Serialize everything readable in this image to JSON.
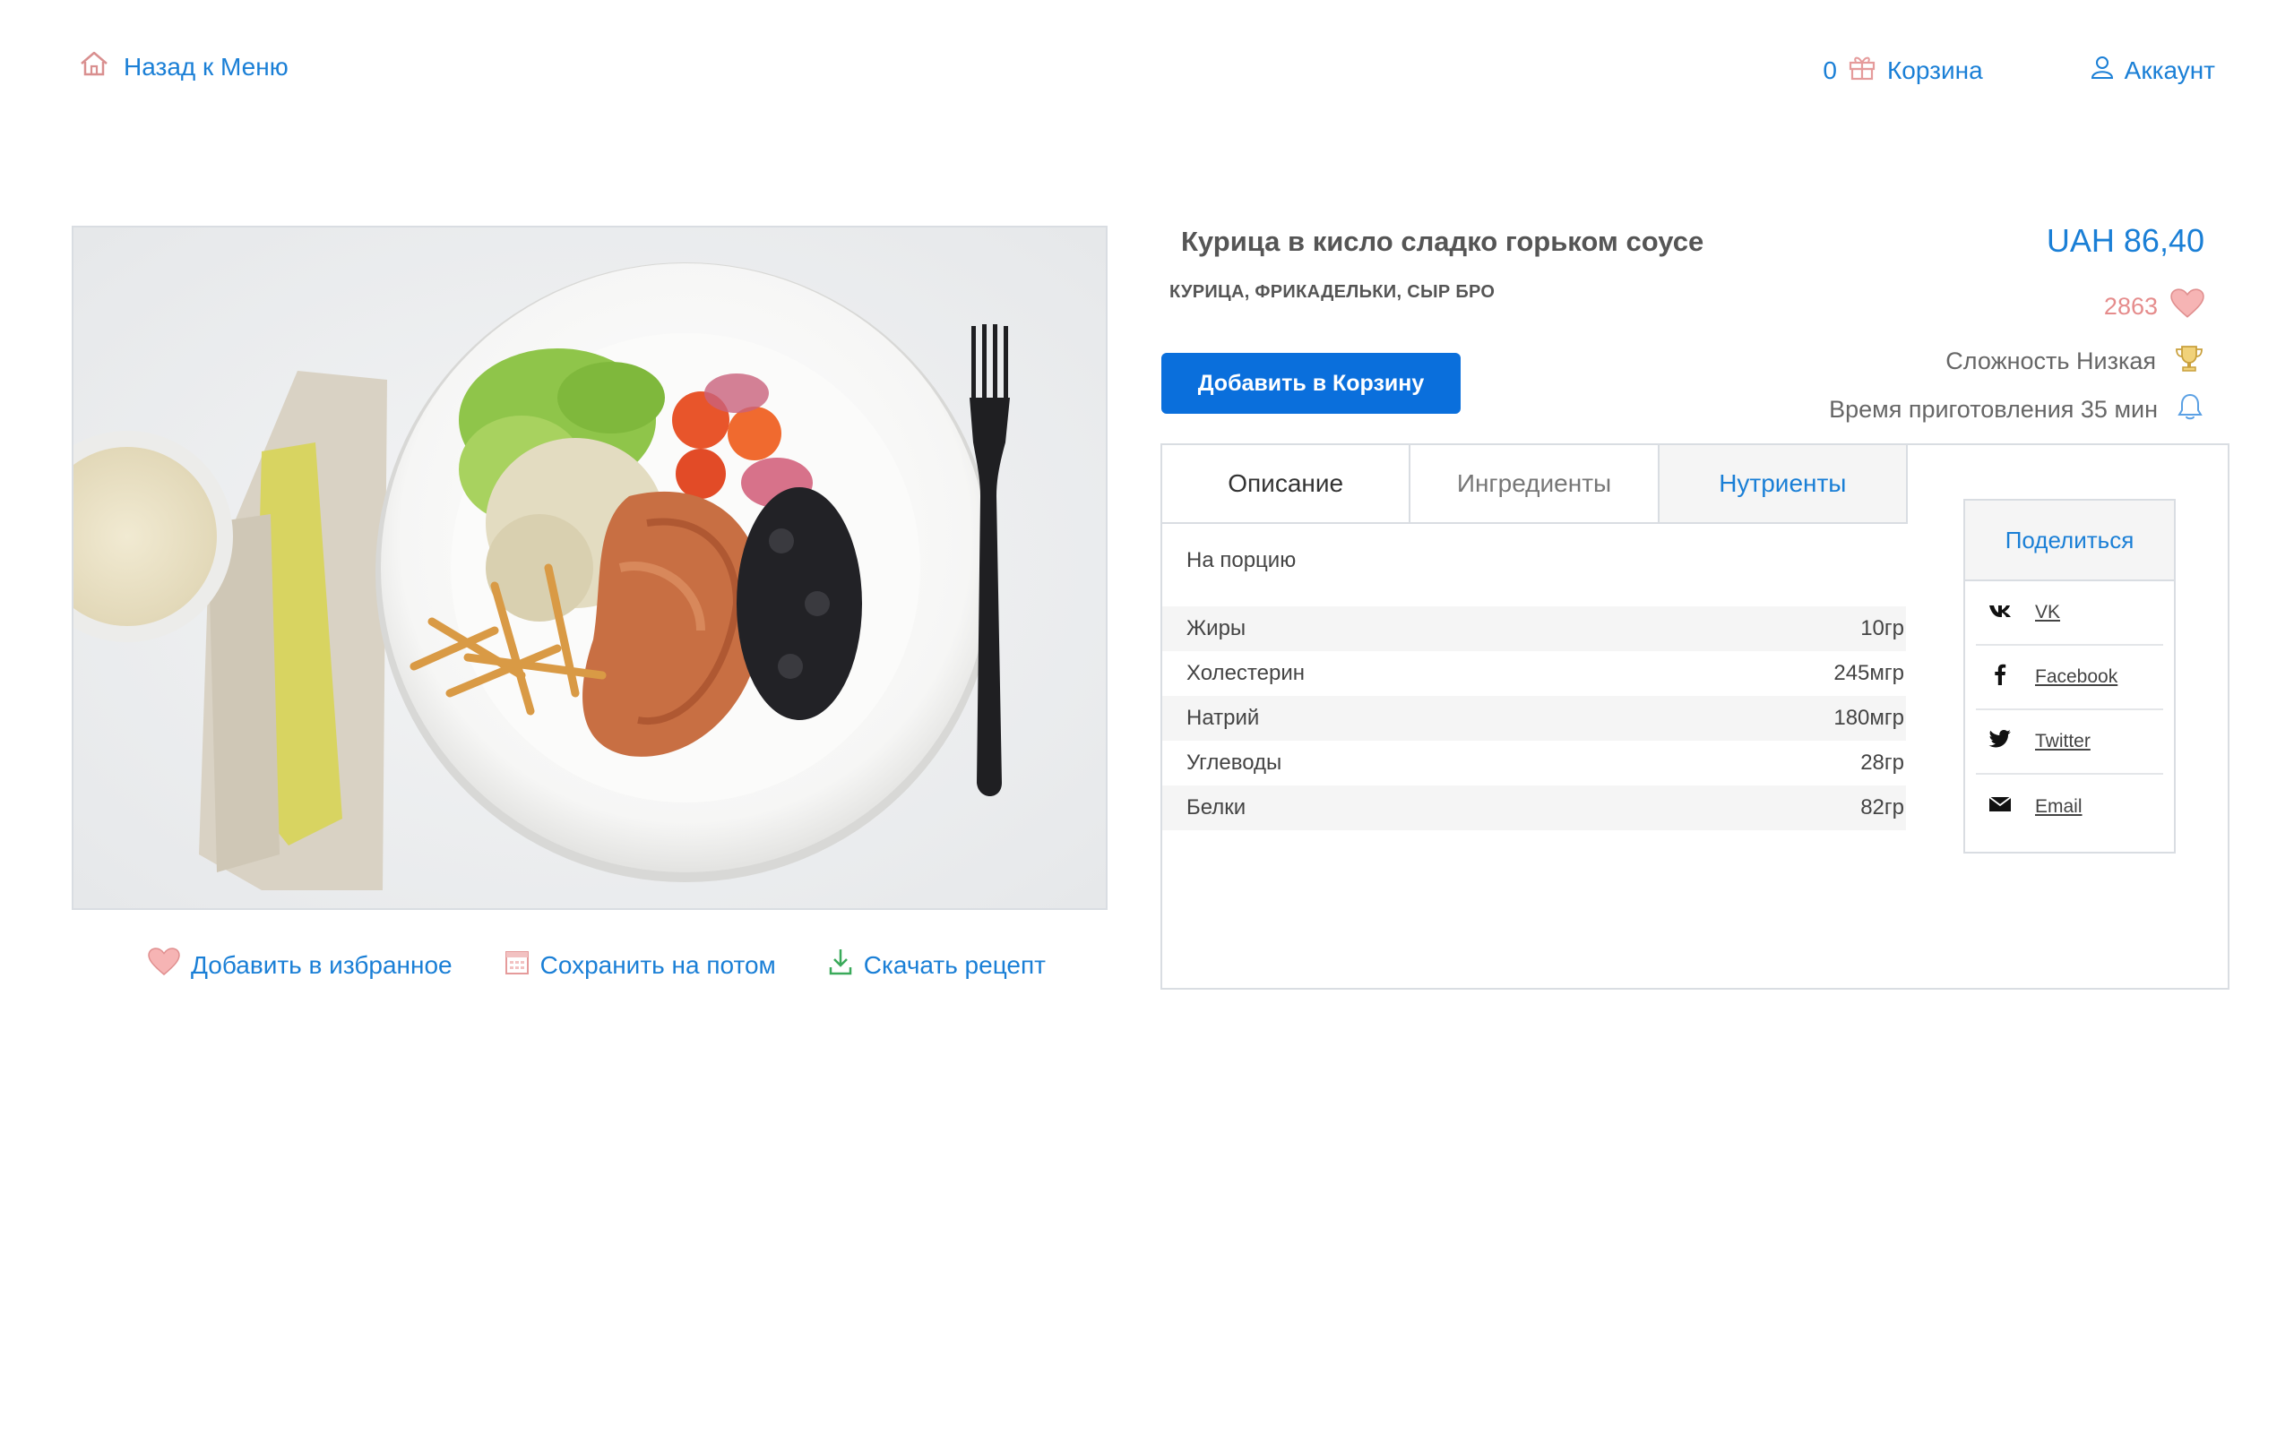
{
  "header": {
    "back_label": "Назад к Меню",
    "cart_count": "0",
    "cart_label": "Корзина",
    "account_label": "Аккаунт"
  },
  "product": {
    "title": "Курица в кисло сладко горьком соусе",
    "subtitle": "КУРИЦА, ФРИКАДЕЛЬКИ, СЫР БРО",
    "price": "UAH 86,40",
    "likes": "2863",
    "add_to_cart": "Добавить в Корзину",
    "difficulty": "Сложность Низкая",
    "cook_time": "Время приготовления 35 мин"
  },
  "photo_actions": {
    "favorite": "Добавить в избранное",
    "save_later": "Сохранить на потом",
    "download": "Скачать рецепт"
  },
  "tabs": [
    {
      "label": "Описание"
    },
    {
      "label": "Ингредиенты"
    },
    {
      "label": "Нутриенты"
    }
  ],
  "active_tab": "Нутриенты",
  "nutrition": {
    "per_portion": "На порцию",
    "rows": [
      {
        "name": "Жиры",
        "value": "10гр"
      },
      {
        "name": "Холестерин",
        "value": "245мгр"
      },
      {
        "name": "Натрий",
        "value": "180мгр"
      },
      {
        "name": "Углеводы",
        "value": "28гр"
      },
      {
        "name": "Белки",
        "value": "82гр"
      }
    ]
  },
  "share": {
    "title": "Поделиться",
    "items": [
      {
        "label": "VK",
        "icon": "vk-icon"
      },
      {
        "label": "Facebook",
        "icon": "facebook-icon"
      },
      {
        "label": "Twitter",
        "icon": "twitter-icon"
      },
      {
        "label": "Email",
        "icon": "email-icon"
      }
    ]
  },
  "colors": {
    "accent": "#1a7fd6",
    "button": "#0a6fdc",
    "likes": "#e58c8c"
  }
}
